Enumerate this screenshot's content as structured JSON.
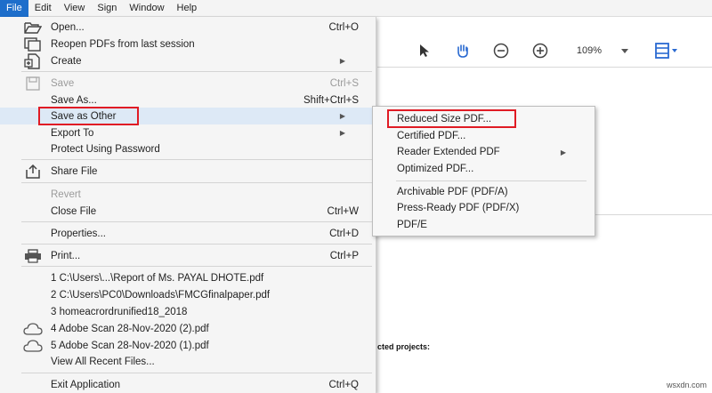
{
  "menubar": [
    {
      "label": "File",
      "active": true
    },
    {
      "label": "Edit",
      "active": false
    },
    {
      "label": "View",
      "active": false
    },
    {
      "label": "Sign",
      "active": false
    },
    {
      "label": "Window",
      "active": false
    },
    {
      "label": "Help",
      "active": false
    }
  ],
  "toolbar": {
    "zoom": "109%",
    "icons": [
      "select-arrow-icon",
      "hand-tool-icon",
      "zoom-out-icon",
      "zoom-in-icon",
      "zoom-dropdown-icon",
      "page-fit-icon"
    ]
  },
  "document": {
    "snippet": "cted projects:"
  },
  "watermark": "wsxdn.com",
  "file_menu": {
    "items": [
      {
        "label": "Open...",
        "shortcut": "Ctrl+O",
        "icon": "folder-open-icon"
      },
      {
        "label": "Reopen PDFs from last session",
        "shortcut": "",
        "icon": "reopen-pdfs-icon"
      },
      {
        "label": "Create",
        "shortcut": "",
        "icon": "create-pdf-icon",
        "submenu": true
      },
      {
        "label": "Save",
        "shortcut": "Ctrl+S",
        "icon": "save-icon",
        "disabled": true
      },
      {
        "label": "Save As...",
        "shortcut": "Shift+Ctrl+S",
        "icon": ""
      },
      {
        "label": "Save as Other",
        "shortcut": "",
        "icon": "",
        "submenu": true,
        "highlighted": true
      },
      {
        "label": "Export To",
        "shortcut": "",
        "icon": "",
        "submenu": true
      },
      {
        "label": "Protect Using Password",
        "shortcut": "",
        "icon": ""
      },
      {
        "label": "Share File",
        "shortcut": "",
        "icon": "share-icon"
      },
      {
        "label": "Revert",
        "shortcut": "",
        "icon": "",
        "disabled": true
      },
      {
        "label": "Close File",
        "shortcut": "Ctrl+W",
        "icon": ""
      },
      {
        "label": "Properties...",
        "shortcut": "Ctrl+D",
        "icon": ""
      },
      {
        "label": "Print...",
        "shortcut": "Ctrl+P",
        "icon": "printer-icon"
      },
      {
        "label": "1 C:\\Users\\...\\Report of Ms. PAYAL DHOTE.pdf",
        "shortcut": "",
        "icon": ""
      },
      {
        "label": "2 C:\\Users\\PC0\\Downloads\\FMCGfinalpaper.pdf",
        "shortcut": "",
        "icon": ""
      },
      {
        "label": "3 homeacrordrunified18_2018",
        "shortcut": "",
        "icon": ""
      },
      {
        "label": "4 Adobe Scan 28-Nov-2020 (2).pdf",
        "shortcut": "",
        "icon": "cloud-icon"
      },
      {
        "label": "5 Adobe Scan 28-Nov-2020 (1).pdf",
        "shortcut": "",
        "icon": "cloud-icon"
      },
      {
        "label": "View All Recent Files...",
        "shortcut": "",
        "icon": ""
      },
      {
        "label": "Exit Application",
        "shortcut": "Ctrl+Q",
        "icon": ""
      }
    ]
  },
  "save_as_other_submenu": {
    "items": [
      {
        "label": "Reduced Size PDF..."
      },
      {
        "label": "Certified PDF..."
      },
      {
        "label": "Reader Extended PDF",
        "submenu": true
      },
      {
        "label": "Optimized PDF..."
      },
      {
        "label": "Archivable PDF (PDF/A)"
      },
      {
        "label": "Press-Ready PDF (PDF/X)"
      },
      {
        "label": "PDF/E"
      }
    ]
  },
  "colors": {
    "menubar_active": "#1d6ecb",
    "menu_highlight": "#dde9f6",
    "callout_red": "#e01b24",
    "disabled_text": "#9b9b9b"
  }
}
